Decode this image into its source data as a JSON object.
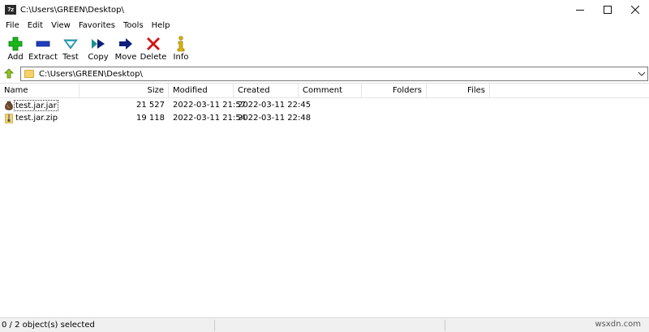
{
  "window": {
    "app_icon_text": "7z",
    "title": "C:\\Users\\GREEN\\Desktop\\"
  },
  "menu": [
    "File",
    "Edit",
    "View",
    "Favorites",
    "Tools",
    "Help"
  ],
  "toolbar": [
    {
      "label": "Add",
      "icon": "plus-icon"
    },
    {
      "label": "Extract",
      "icon": "minus-icon"
    },
    {
      "label": "Test",
      "icon": "check-icon"
    },
    {
      "label": "Copy",
      "icon": "double-arrow-icon"
    },
    {
      "label": "Move",
      "icon": "arrow-right-icon"
    },
    {
      "label": "Delete",
      "icon": "x-icon"
    },
    {
      "label": "Info",
      "icon": "info-icon"
    }
  ],
  "address": {
    "path": "C:\\Users\\GREEN\\Desktop\\"
  },
  "columns": [
    "Name",
    "Size",
    "Modified",
    "Created",
    "Comment",
    "Folders",
    "Files"
  ],
  "files": [
    {
      "name": "test.jar.jar",
      "size": "21 527",
      "modified": "2022-03-11 21:57",
      "created": "2022-03-11 22:45",
      "icon": "jar-icon"
    },
    {
      "name": "test.jar.zip",
      "size": "19 118",
      "modified": "2022-03-11 21:54",
      "created": "2022-03-11 22:48",
      "icon": "zip-icon"
    }
  ],
  "status": {
    "selection": "0 / 2 object(s) selected",
    "watermark": "wsxdn.com"
  },
  "colors": {
    "add": "#18b818",
    "extract": "#1f3fbf",
    "test": "#2fb3c9",
    "copy": "#1a8f8f",
    "move": "#0c1f7a",
    "delete": "#d21414",
    "info": "#e0b400"
  }
}
